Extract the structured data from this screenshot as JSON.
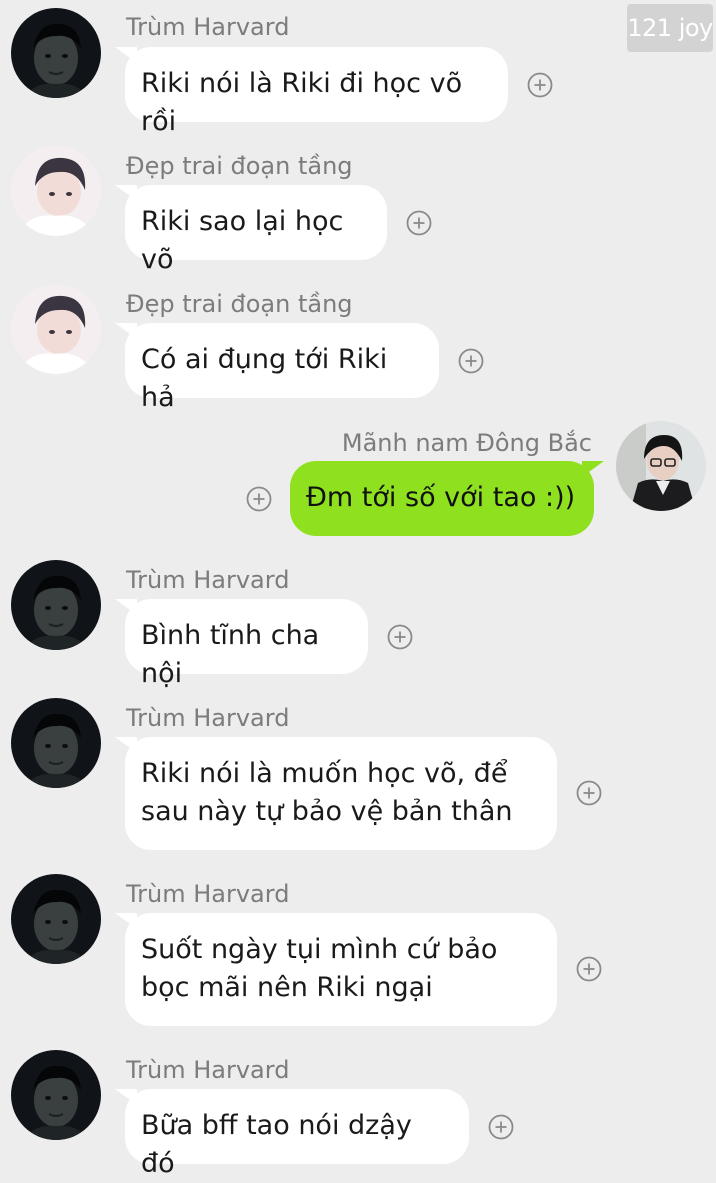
{
  "watermark": "121 joy",
  "colors": {
    "background": "#ededed",
    "incoming_bubble": "#ffffff",
    "outgoing_bubble": "#8fe11f",
    "sender_text": "#7c7c7c"
  },
  "messages": [
    {
      "sender": "Trùm Harvard",
      "text": "Riki nói là Riki đi học võ rồi"
    },
    {
      "sender": "Đẹp trai đoạn tầng",
      "text": "Riki sao lại học võ"
    },
    {
      "sender": "Đẹp trai đoạn tầng",
      "text": "Có ai đụng tới Riki hả"
    },
    {
      "sender": "Mãnh nam Đông Bắc",
      "text": "Đm tới số với tao :))"
    },
    {
      "sender": "Trùm Harvard",
      "text": "Bình tĩnh cha nội"
    },
    {
      "sender": "Trùm Harvard",
      "text": "Riki nói là muốn học võ, để\nsau này tự bảo vệ bản thân"
    },
    {
      "sender": "Trùm Harvard",
      "text": "Suốt ngày tụi mình cứ bảo\nbọc mãi nên Riki ngại"
    },
    {
      "sender": "Trùm Harvard",
      "text": "Bữa bff tao nói dzậy đó"
    }
  ]
}
